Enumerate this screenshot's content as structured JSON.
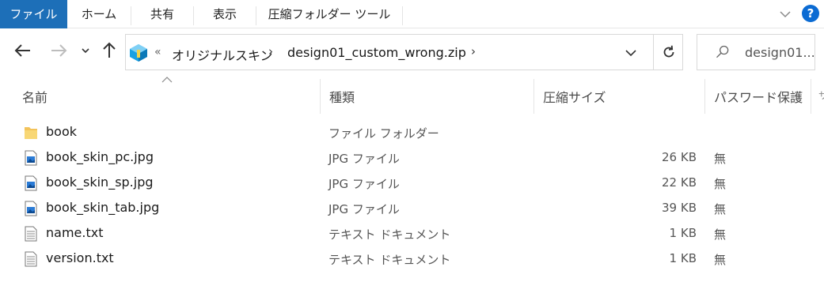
{
  "ribbon": {
    "tabs": [
      "ファイル",
      "ホーム",
      "共有",
      "表示",
      "圧縮フォルダー ツール"
    ],
    "help_label": "?"
  },
  "nav": {
    "breadcrumb_overflow": "«",
    "breadcrumb": [
      "オリジナルスキン",
      "design01_custom_wrong.zip"
    ],
    "search_placeholder": "design01..."
  },
  "columns": {
    "name": "名前",
    "type": "種類",
    "compressed_size": "圧縮サイズ",
    "password": "パスワード保護",
    "more": "サ"
  },
  "files": [
    {
      "name": "book",
      "type": "ファイル フォルダー",
      "size": "",
      "password": "",
      "icon": "folder-icon"
    },
    {
      "name": "book_skin_pc.jpg",
      "type": "JPG ファイル",
      "size": "26 KB",
      "password": "無",
      "icon": "image-file-icon"
    },
    {
      "name": "book_skin_sp.jpg",
      "type": "JPG ファイル",
      "size": "22 KB",
      "password": "無",
      "icon": "image-file-icon"
    },
    {
      "name": "book_skin_tab.jpg",
      "type": "JPG ファイル",
      "size": "39 KB",
      "password": "無",
      "icon": "image-file-icon"
    },
    {
      "name": "name.txt",
      "type": "テキスト ドキュメント",
      "size": "1 KB",
      "password": "無",
      "icon": "text-file-icon"
    },
    {
      "name": "version.txt",
      "type": "テキスト ドキュメント",
      "size": "1 KB",
      "password": "無",
      "icon": "text-file-icon"
    }
  ],
  "colors": {
    "file_tab": "#1d6fb8",
    "help": "#0b6bd3",
    "folder": "#f3c35a"
  }
}
